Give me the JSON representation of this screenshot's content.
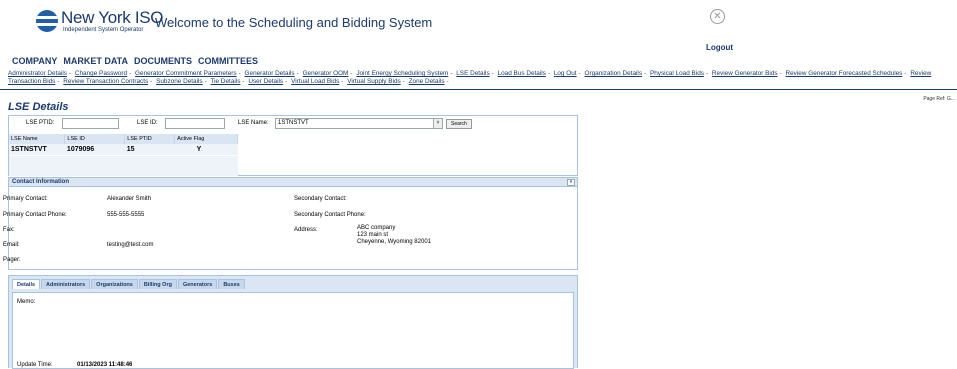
{
  "header": {
    "logo_name": "New York ISO",
    "logo_sub": "Independent System Operator",
    "welcome": "Welcome to the Scheduling and Bidding System",
    "close_glyph": "✕",
    "logout": "Logout"
  },
  "main_nav": [
    "COMPANY",
    "MARKET DATA",
    "DOCUMENTS",
    "COMMITTEES"
  ],
  "links": [
    "Administrator Details",
    "Change Password",
    "Generator Commitment Parameters",
    "Generator Details",
    "Generator OOM",
    "Joint Energy Scheduling System",
    "LSE Details",
    "Load Bus Details",
    "Log Out",
    "Organization Details",
    "Physical Load Bids",
    "Review Generator Bids",
    "Review Generator Forecasted Schedules",
    "Review Transaction Bids",
    "Review Transaction Contracts",
    "Subzone Details",
    "Tie Details",
    "User Details",
    "Virtual Load Bids",
    "Virtual Supply Bids",
    "Zone Details"
  ],
  "page_ref": "Page Ref: G...",
  "page_title": "LSE Details",
  "search": {
    "ptid_label": "LSE PTID:",
    "ptid_value": "",
    "id_label": "LSE ID:",
    "id_value": "",
    "name_label": "LSE Name:",
    "name_value": "1STNSTVT",
    "dropdown_glyph": "˅",
    "button": "Search"
  },
  "results": {
    "headers": [
      "LSE Name",
      "LSE ID",
      "LSE PTID",
      "Active Flag"
    ],
    "row": [
      "1STNSTVT",
      "1079096",
      "15",
      "Y"
    ]
  },
  "contact": {
    "title": "Contact Information",
    "collapse_glyph": "»",
    "primary_contact_label": "Primary Contact:",
    "primary_contact": "Alexander Smith",
    "primary_phone_label": "Primary Contact Phone:",
    "primary_phone": "555-555-5555",
    "fax_label": "Fax:",
    "email_label": "Email:",
    "email": "testing@test.com",
    "pager_label": "Pager:",
    "secondary_contact_label": "Secondary Contact:",
    "secondary_phone_label": "Secondary Contact Phone:",
    "address_label": "Address:",
    "address_line1": "ABC company",
    "address_line2": "123 main st",
    "address_line3": "Cheyenne, Wyoming 82001"
  },
  "tabs": [
    "Details",
    "Administrators",
    "Organizations",
    "Billing Org",
    "Generators",
    "Buses"
  ],
  "details": {
    "memo_label": "Memo:",
    "update_label": "Update Time:",
    "update_value": "01/13/2023 11:48:46"
  }
}
